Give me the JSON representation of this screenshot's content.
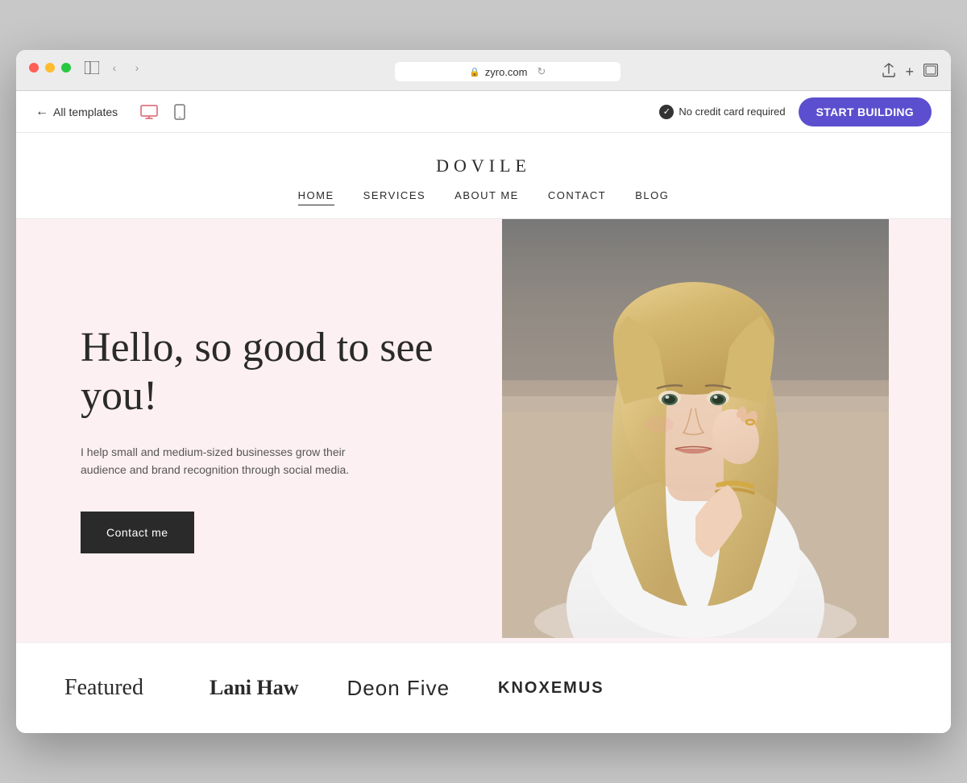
{
  "browser": {
    "url": "zyro.com",
    "traffic_lights": [
      "red",
      "yellow",
      "green"
    ]
  },
  "toolbar": {
    "back_label": "All templates",
    "no_credit_card_label": "No credit card required",
    "start_building_label": "START BUILDING",
    "device_icons": [
      "desktop",
      "mobile"
    ]
  },
  "site": {
    "brand": "DOVILE",
    "nav": {
      "items": [
        {
          "label": "HOME",
          "active": true
        },
        {
          "label": "SERVICES",
          "active": false
        },
        {
          "label": "ABOUT ME",
          "active": false
        },
        {
          "label": "CONTACT",
          "active": false
        },
        {
          "label": "BLOG",
          "active": false
        }
      ]
    },
    "hero": {
      "title": "Hello, so good to see you!",
      "subtitle": "I help small and medium-sized businesses grow their audience and brand recognition through social media.",
      "cta_label": "Contact me"
    },
    "featured": {
      "section_label": "Featured",
      "logos": [
        {
          "text": "Lani Haw",
          "style": "serif-bold"
        },
        {
          "text": "Deon Five",
          "style": "light-text"
        },
        {
          "text": "KNOXEMUS",
          "style": "caps"
        }
      ]
    }
  },
  "colors": {
    "accent_purple": "#5b4fcf",
    "hero_bg": "#fdf0f2",
    "dark": "#2a2a2a",
    "nav_active_underline": "#2a2a2a"
  }
}
